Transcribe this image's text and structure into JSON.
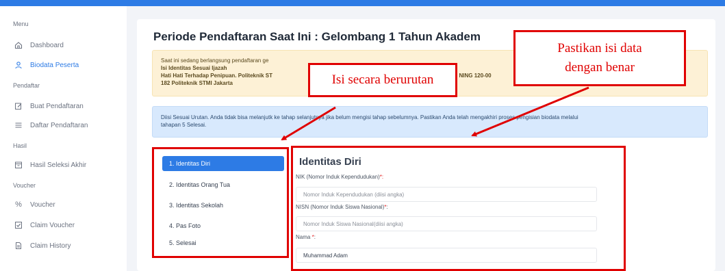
{
  "sidebar": {
    "sections": [
      {
        "label": "Menu"
      },
      {
        "label": "Pendaftar"
      },
      {
        "label": "Hasil"
      },
      {
        "label": "Voucher"
      }
    ],
    "items": [
      {
        "label": "Dashboard",
        "icon": "home-icon"
      },
      {
        "label": "Biodata Peserta",
        "icon": "user-icon",
        "active": true
      },
      {
        "label": "Buat Pendaftaran",
        "icon": "edit-icon"
      },
      {
        "label": "Daftar Pendaftaran",
        "icon": "list-icon"
      },
      {
        "label": "Hasil Seleksi Akhir",
        "icon": "inbox-icon"
      },
      {
        "label": "Voucher",
        "icon": "percent-icon"
      },
      {
        "label": "Claim Voucher",
        "icon": "check-square-icon"
      },
      {
        "label": "Claim History",
        "icon": "file-icon"
      }
    ]
  },
  "main": {
    "title": "Periode Pendaftaran Saat Ini : Gelombang 1 Tahun Akadem",
    "warning": {
      "line1": "Saat ini sedang berlangsung pendaftaran ge",
      "line2": "Isi Identitas Sesuai Ijazah",
      "line3a": "Hati Hati Terhadap Penipuan. Politeknik ST",
      "line3b": "NING 120-00",
      "line4": "182 Politeknik STMI Jakarta"
    },
    "info": {
      "text_a": "Diisi Sesuai Urutan. Anda tidak bisa melanjutk",
      "text_b": " ke tahap selanjutnya jika belum mengisi tahap sebelumnya. Pastikan Anda",
      "text_c": " telah mengakhiri proses pengisian biodata melalui",
      "text_d": "tahapan 5 Selesai."
    },
    "steps": [
      {
        "label": "1. Identitas Diri",
        "active": true
      },
      {
        "label": "2. Identitas Orang Tua"
      },
      {
        "label": "3. Identitas Sekolah"
      },
      {
        "label": "4. Pas Foto"
      },
      {
        "label": "5. Selesai"
      }
    ],
    "form": {
      "title": "Identitas Diri",
      "nik_label": "NIK (Nomor Induk Kependudukan)",
      "nik_placeholder": "Nomor Induk Kependudukan (diisi angka)",
      "nisn_label": "NISN (Nomor Induk Siswa Nasional)",
      "nisn_placeholder": "Nomor Induk Siswa Nasional(diisi angka)",
      "nama_label": "Nama ",
      "nama_value": "Muhammad Adam",
      "required_mark": "*",
      "required_mark_colon": "*:",
      "colon": ":"
    }
  },
  "annotations": {
    "callout_order": "Isi secara berurutan",
    "callout_verify_line1": "Pastikan isi data",
    "callout_verify_line2": "dengan benar",
    "color": "#e00000"
  },
  "colors": {
    "accent": "#2d7be5",
    "warning_bg": "#fdf1d6",
    "info_bg": "#d8e9fd",
    "required": "#e11d1d"
  }
}
